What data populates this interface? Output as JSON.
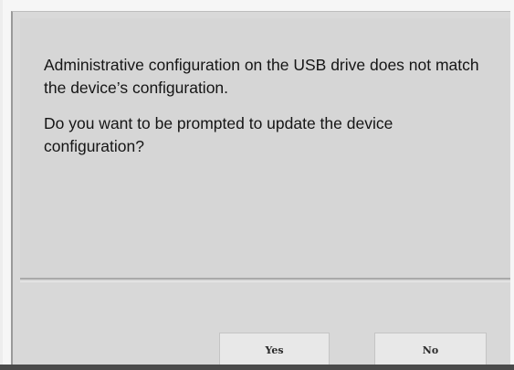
{
  "dialog": {
    "message_line_1": "Administrative configuration on the USB drive does not match the device’s configuration.",
    "message_line_2": "Do you want to be prompted to update the device configuration?"
  },
  "buttons": {
    "yes_label": "Yes",
    "no_label": "No"
  }
}
